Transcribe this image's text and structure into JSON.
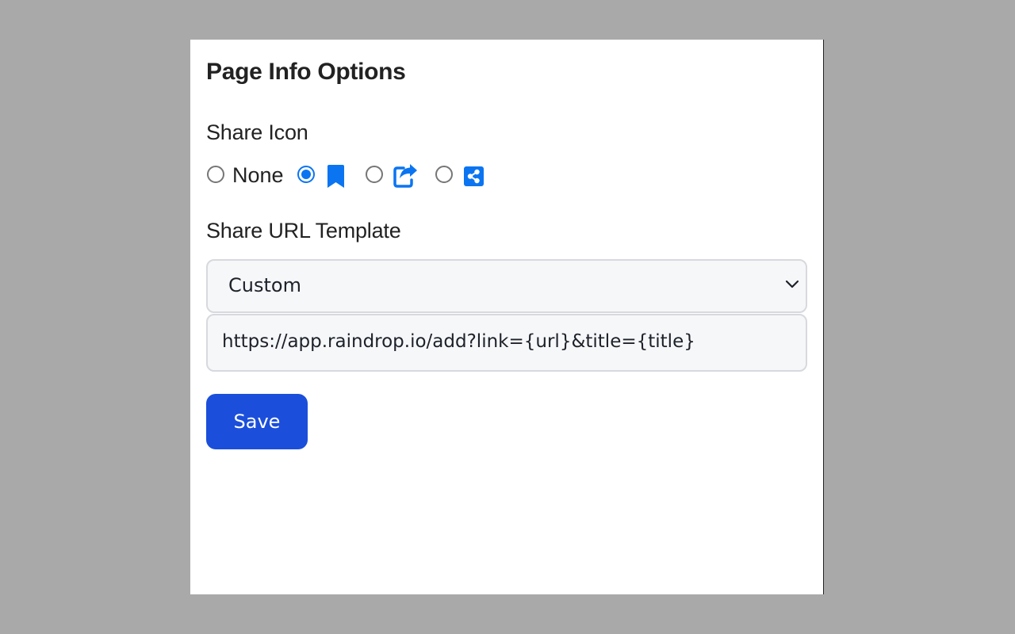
{
  "page": {
    "title": "Page Info Options"
  },
  "share_icon": {
    "label": "Share Icon",
    "options": [
      {
        "label": "None",
        "icon": null,
        "checked": false
      },
      {
        "label": "",
        "icon": "bookmark-icon",
        "checked": true
      },
      {
        "label": "",
        "icon": "share-arrow-icon",
        "checked": false
      },
      {
        "label": "",
        "icon": "share-nodes-icon",
        "checked": false
      }
    ]
  },
  "share_url": {
    "label": "Share URL Template",
    "select_value": "Custom",
    "template_value": "https://app.raindrop.io/add?link={url}&title={title}"
  },
  "actions": {
    "save_label": "Save"
  },
  "colors": {
    "accent": "#0b75f1",
    "button": "#1b4fdb",
    "background": "#a9a9a9"
  }
}
